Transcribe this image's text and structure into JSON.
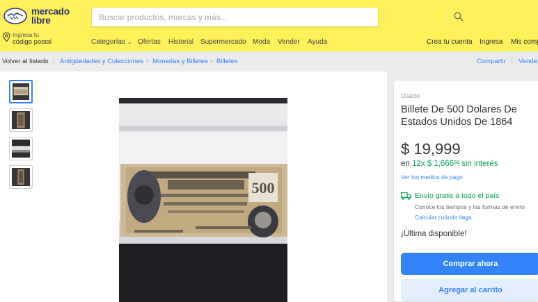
{
  "header": {
    "logo_line1": "mercado",
    "logo_line2": "libre",
    "search_placeholder": "Buscar productos, marcas y más...",
    "location_small": "Ingresa tu",
    "location_main": "código postal",
    "nav": {
      "categories": "Categorías",
      "offers": "Ofertas",
      "history": "Historial",
      "supermarket": "Supermercado",
      "fashion": "Moda",
      "sell": "Vender",
      "help": "Ayuda"
    },
    "account": {
      "create": "Crea tu cuenta",
      "login": "Ingresa",
      "purchases": "Mis comp"
    },
    "colors": {
      "header_bg": "#fff159",
      "brand_text": "#2d3277"
    }
  },
  "breadcrumb": {
    "back": "Volver al listado",
    "items": [
      "Antigüedades y Colecciones",
      "Monedas y Billetes",
      "Billetes"
    ],
    "share": "Compartir",
    "sell_one": "Vende"
  },
  "gallery": {
    "thumbnails": [
      "banknote-photo-1",
      "banknote-photo-2",
      "banknote-photo-3",
      "banknote-photo-4"
    ],
    "selected_index": 0
  },
  "product": {
    "condition": "Usado",
    "title": "Billete De 500 Dolares De Estados Unidos De 1864",
    "price": "$ 19,999",
    "installments_prefix": "en ",
    "installments_count": "12x",
    "installment_amount": "$ 1,666",
    "installment_cents": "58",
    "installments_suffix": " sin interés",
    "payment_methods": "Ver los medios de pago",
    "shipping_title": "Envío gratis a todo el país",
    "shipping_sub": "Conoce los tiempos y las formas de envío",
    "shipping_link": "Calcular cuándo llega",
    "stock": "¡Última disponible!",
    "buy_now": "Comprar ahora",
    "add_to_cart": "Agregar al carrito"
  },
  "colors": {
    "link": "#3483fa",
    "success": "#00a650",
    "primary_button": "#3483fa",
    "secondary_button": "#e3edfb"
  }
}
